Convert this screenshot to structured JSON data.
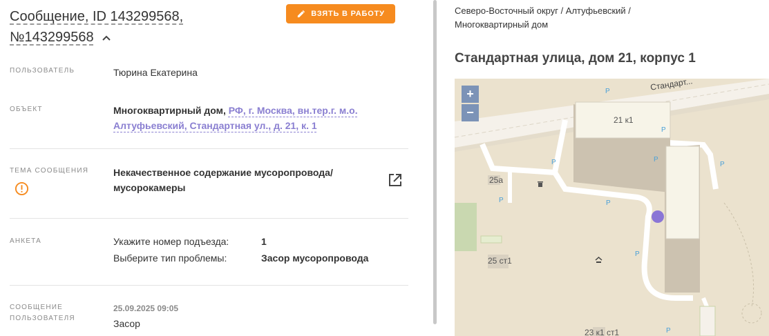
{
  "header": {
    "title_line1": "Сообщение, ID 143299568,",
    "title_line2": "№143299568",
    "take_button": "ВЗЯТЬ В РАБОТУ"
  },
  "fields": {
    "user_label": "ПОЛЬЗОВАТЕЛЬ",
    "user_value": "Тюрина Екатерина",
    "object_label": "ОБЪЕКТ",
    "object_type": "Многоквартирный дом,",
    "object_link_line1": "РФ, г. Москва, вн.тер.г. м.о.",
    "object_link_line2": "Алтуфьевский, Стандартная ул., д. 21, к. 1",
    "topic_label": "ТЕМА СООБЩЕНИЯ",
    "topic_line1": "Некачественное содержание мусоропровода/",
    "topic_line2": "мусорокамеры",
    "anketa_label": "АНКЕТА",
    "anketa": [
      {
        "q": "Укажите номер подъезда:",
        "a": "1"
      },
      {
        "q": "Выберите тип проблемы:",
        "a": "Засор мусоропровода"
      }
    ],
    "message_label_line1": "СООБЩЕНИЕ",
    "message_label_line2": "ПОЛЬЗОВАТЕЛЯ",
    "message_date": "25.09.2025 09:05",
    "message_text": "Засор"
  },
  "right": {
    "breadcrumb_line1": "Северо-Восточный округ / Алтуфьевский /",
    "breadcrumb_line2": "Многоквартирный дом",
    "address": "Стандартная улица, дом 21, корпус 1"
  },
  "map": {
    "zoom_in": "+",
    "zoom_out": "−",
    "street_label": "Стандарт...",
    "building_main": "21 к1",
    "label_25a": "25а",
    "label_25st1": "25 ст1",
    "label_23k1": "23 к1 ст1",
    "parking": "P",
    "marker_color": "#8a75d6"
  },
  "colors": {
    "accent": "#f68b1f",
    "link": "#8a7fd1",
    "warning": "#f68b1f"
  }
}
